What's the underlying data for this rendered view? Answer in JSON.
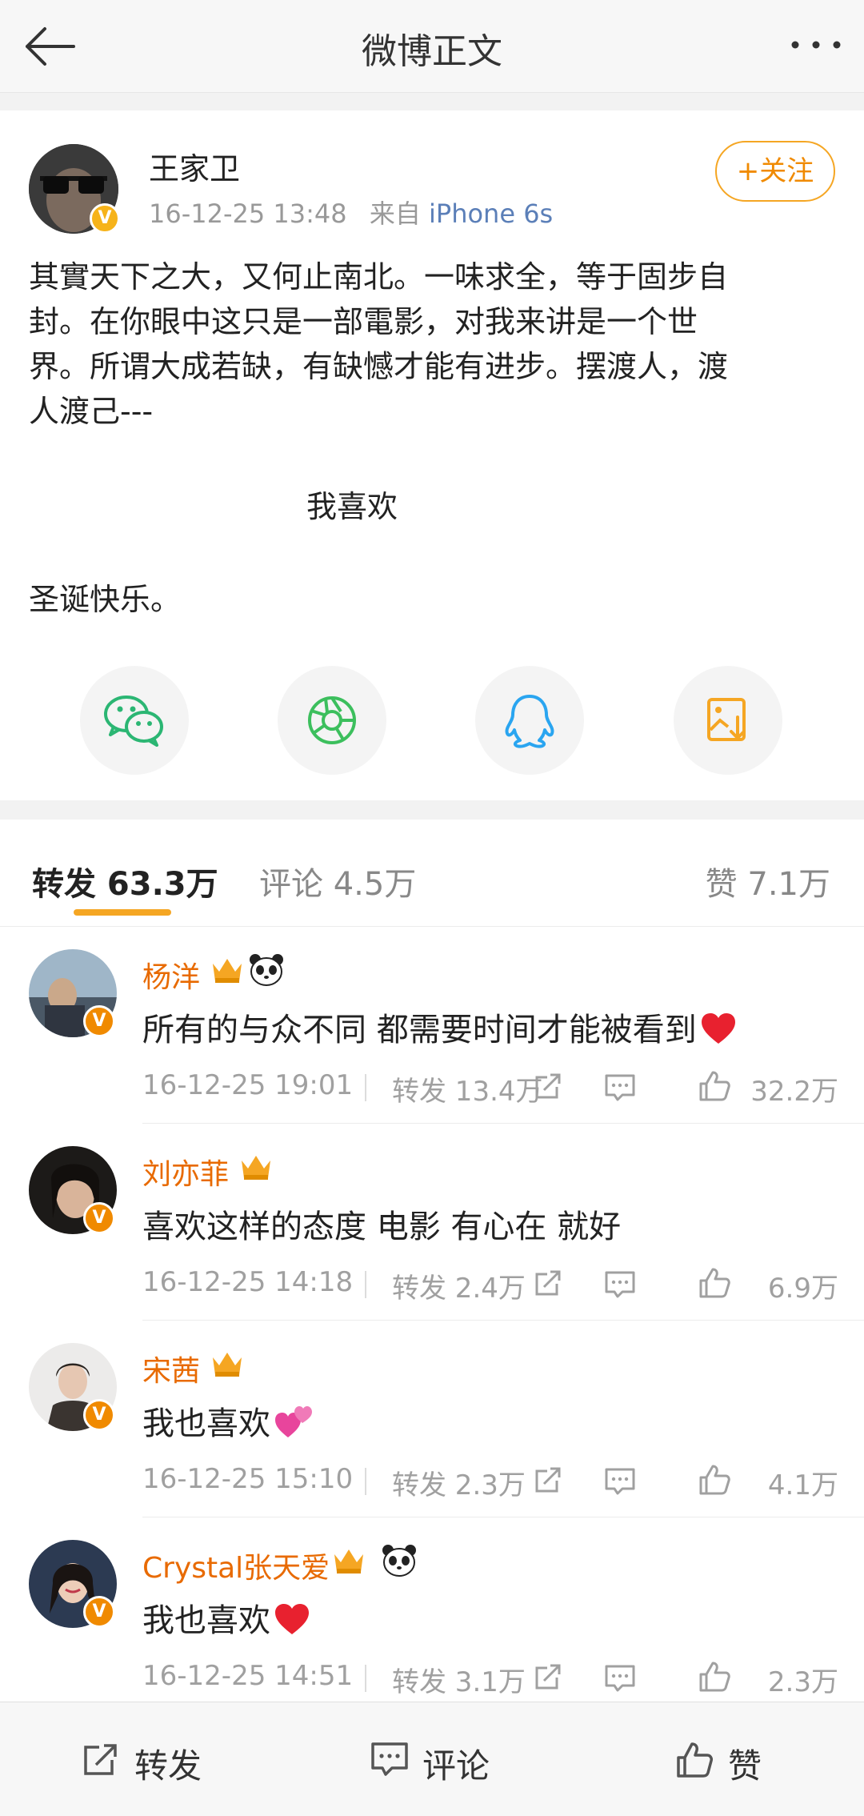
{
  "header": {
    "title": "微博正文",
    "back_icon": "arrow-left-icon",
    "more_icon": "more-dots-icon"
  },
  "post": {
    "author": "王家卫",
    "time": "16-12-25 13:48",
    "source_prefix": "来自",
    "source": "iPhone 6s",
    "follow_label": "+关注",
    "lines": [
      "其實天下之大，又何止南北。一味求全，等于固步自",
      "封。在你眼中这只是一部電影，对我来讲是一个世",
      "界。所谓大成若缺，有缺憾才能有进步。摆渡人，渡",
      "人渡己---"
    ],
    "center_line": "我喜欢",
    "closing_line": "圣诞快乐。",
    "share_icons": [
      "wechat-icon",
      "moments-icon",
      "qq-icon",
      "save-image-icon"
    ]
  },
  "tabs": {
    "repost": "转发 63.3万",
    "comment": "评论 4.5万",
    "like": "赞 7.1万"
  },
  "comments": [
    {
      "name": "杨洋",
      "badges": [
        "crown-icon",
        "panda-icon"
      ],
      "text": "所有的与众不同 都需要时间才能被看到",
      "emoji": "heart",
      "time": "16-12-25 19:01",
      "repost": "转发 13.4万",
      "likes": "32.2万"
    },
    {
      "name": "刘亦菲",
      "badges": [
        "crown-icon"
      ],
      "text": "喜欢这样的态度 电影 有心在 就好",
      "emoji": "",
      "time": "16-12-25 14:18",
      "repost": "转发 2.4万",
      "likes": "6.9万"
    },
    {
      "name": "宋茜",
      "badges": [
        "crown-icon"
      ],
      "text": "我也喜欢",
      "emoji": "two-hearts",
      "time": "16-12-25 15:10",
      "repost": "转发 2.3万",
      "likes": "4.1万"
    },
    {
      "name": "Crystal张天爱",
      "badges": [
        "crown-icon",
        "panda-icon"
      ],
      "text": "我也喜欢",
      "emoji": "heart",
      "time": "16-12-25 14:51",
      "repost": "转发 3.1万",
      "likes": "2.3万"
    }
  ],
  "bottom": {
    "repost": "转发",
    "comment": "评论",
    "like": "赞"
  },
  "colors": {
    "accent": "#f5a623",
    "name": "#e86a00",
    "link": "#5b7fb8",
    "heart": "#e8212f"
  }
}
